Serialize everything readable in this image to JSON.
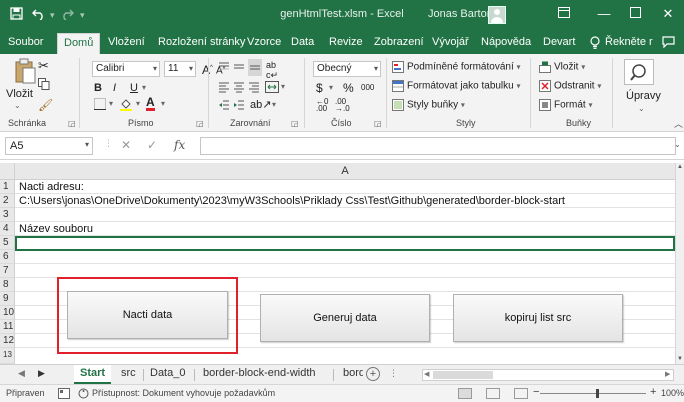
{
  "titlebar": {
    "save_icon": "save-icon",
    "undo_icon": "undo-icon",
    "redo_icon": "redo-icon",
    "doc_title": "genHtmlTest.xlsm  -  Excel",
    "user": "Jonas Barton",
    "bg_color": "#217346"
  },
  "menu": {
    "tabs": [
      "Soubor",
      "Domů",
      "Vložení",
      "Rozložení stránky",
      "Vzorce",
      "Data",
      "Revize",
      "Zobrazení",
      "Vývojář",
      "Nápověda",
      "Devart",
      "Řekněte r"
    ],
    "active": "Domů"
  },
  "ribbon": {
    "clipboard": {
      "paste": "Vložit",
      "label": "Schránka"
    },
    "font": {
      "name": "Calibri",
      "size": "11",
      "bold": "B",
      "italic": "I",
      "underline": "U",
      "grow": "A",
      "shrink": "A",
      "font_color_letter": "A",
      "label": "Písmo"
    },
    "alignment": {
      "label": "Zarovnání"
    },
    "number": {
      "format": "Obecný",
      "currency": "$",
      "percent": "%",
      "thousands": "000",
      "label": "Číslo"
    },
    "styles": {
      "conditional": "Podmíněné formátování",
      "as_table": "Formátovat jako tabulku",
      "cell_styles": "Styly buňky",
      "label": "Styly"
    },
    "cells": {
      "insert": "Vložit",
      "delete": "Odstranit",
      "format": "Formát",
      "label": "Buňky"
    },
    "editing": {
      "label": "Úpravy"
    }
  },
  "formula_bar": {
    "name_box": "A5",
    "fx": "fx",
    "value": ""
  },
  "grid": {
    "column": "A",
    "rows": [
      "1",
      "2",
      "3",
      "4",
      "5",
      "6",
      "7",
      "8",
      "9",
      "10",
      "11",
      "12",
      "13"
    ],
    "cells": {
      "a1": "Nacti adresu:",
      "a2": "C:\\Users\\jonas\\OneDrive\\Dokumenty\\2023\\myW3Schools\\Priklady Css\\Test\\Github\\generated\\border-block-start",
      "a4": "Název souboru"
    },
    "buttons": {
      "load": "Nacti data",
      "generate": "Generuj data",
      "copy": "kopiruj list src"
    },
    "highlight_color": "#e0202a"
  },
  "sheets": {
    "tabs": [
      "Start",
      "src",
      "Data_0",
      "border-block-end-width",
      "borde ..."
    ],
    "active": "Start"
  },
  "status": {
    "ready": "Připraven",
    "accessibility": "Přístupnost: Dokument vyhovuje požadavkům",
    "zoom": "100%"
  }
}
